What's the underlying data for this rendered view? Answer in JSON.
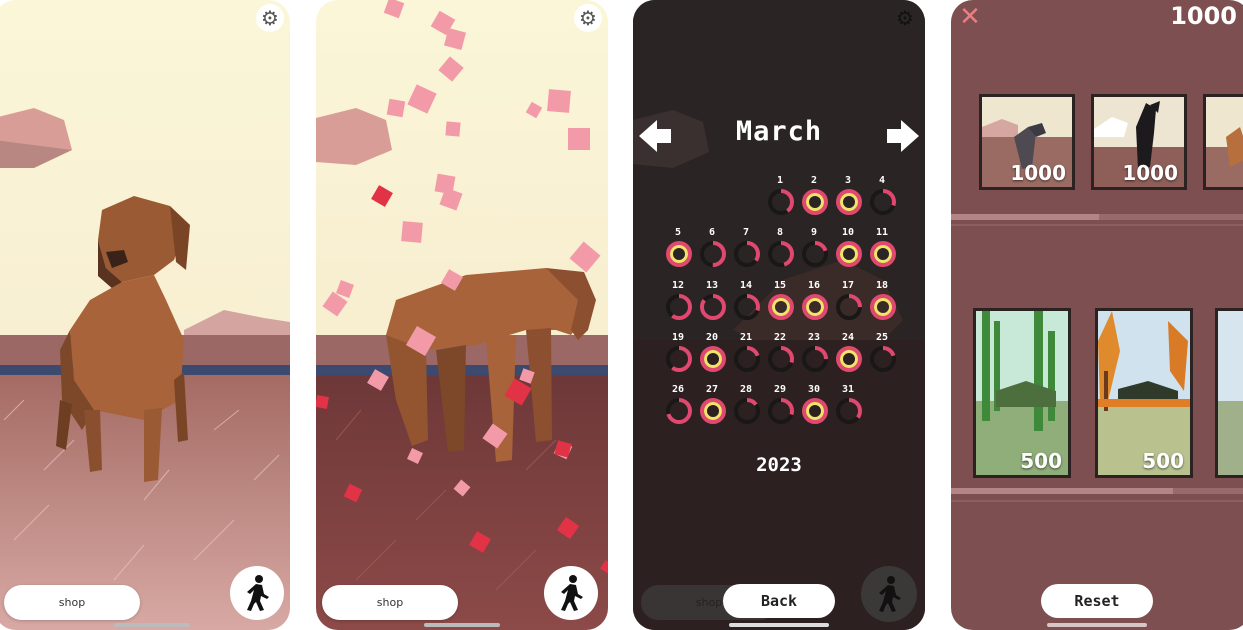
{
  "screens": {
    "home": {
      "shop_label": "shop",
      "settings_icon": "gear-icon",
      "walk_icon": "walking-person-icon"
    },
    "petals": {
      "shop_label": "shop",
      "settings_icon": "gear-icon",
      "walk_icon": "walking-person-icon"
    },
    "calendar": {
      "month": "March",
      "year": "2023",
      "back_label": "Back",
      "shop_label": "shop",
      "prev_icon": "arrow-left-icon",
      "next_icon": "arrow-right-icon",
      "days": [
        {
          "n": "1",
          "progress": 0.4
        },
        {
          "n": "2",
          "progress": 1
        },
        {
          "n": "3",
          "progress": 1
        },
        {
          "n": "4",
          "progress": 0.3
        },
        {
          "n": "5",
          "progress": 1
        },
        {
          "n": "6",
          "progress": 0.5
        },
        {
          "n": "7",
          "progress": 0.35
        },
        {
          "n": "8",
          "progress": 0.45
        },
        {
          "n": "9",
          "progress": 0.2
        },
        {
          "n": "10",
          "progress": 1
        },
        {
          "n": "11",
          "progress": 1
        },
        {
          "n": "12",
          "progress": 0.6
        },
        {
          "n": "13",
          "progress": 0.85
        },
        {
          "n": "14",
          "progress": 0.3
        },
        {
          "n": "15",
          "progress": 1
        },
        {
          "n": "16",
          "progress": 1
        },
        {
          "n": "17",
          "progress": 0.25
        },
        {
          "n": "18",
          "progress": 1
        },
        {
          "n": "19",
          "progress": 0.6
        },
        {
          "n": "20",
          "progress": 1
        },
        {
          "n": "21",
          "progress": 0.2
        },
        {
          "n": "22",
          "progress": 0.3
        },
        {
          "n": "23",
          "progress": 0.25
        },
        {
          "n": "24",
          "progress": 1
        },
        {
          "n": "25",
          "progress": 0.2
        },
        {
          "n": "26",
          "progress": 0.7
        },
        {
          "n": "27",
          "progress": 1
        },
        {
          "n": "28",
          "progress": 0.15
        },
        {
          "n": "29",
          "progress": 0.3
        },
        {
          "n": "30",
          "progress": 1
        },
        {
          "n": "31",
          "progress": 0.35
        }
      ]
    },
    "shop": {
      "coins": "1000",
      "close_icon": "close-icon",
      "reset_label": "Reset",
      "dogs": [
        {
          "price": "1000"
        },
        {
          "price": "1000"
        }
      ],
      "scenes": [
        {
          "price": "500"
        },
        {
          "price": "500"
        }
      ]
    }
  },
  "colors": {
    "sky": "#faf3d2",
    "ring_pink": "#e0486f",
    "ring_yellow": "#f2e36a",
    "shop_bg": "#7d4f50",
    "close_x": "#e87e80"
  }
}
